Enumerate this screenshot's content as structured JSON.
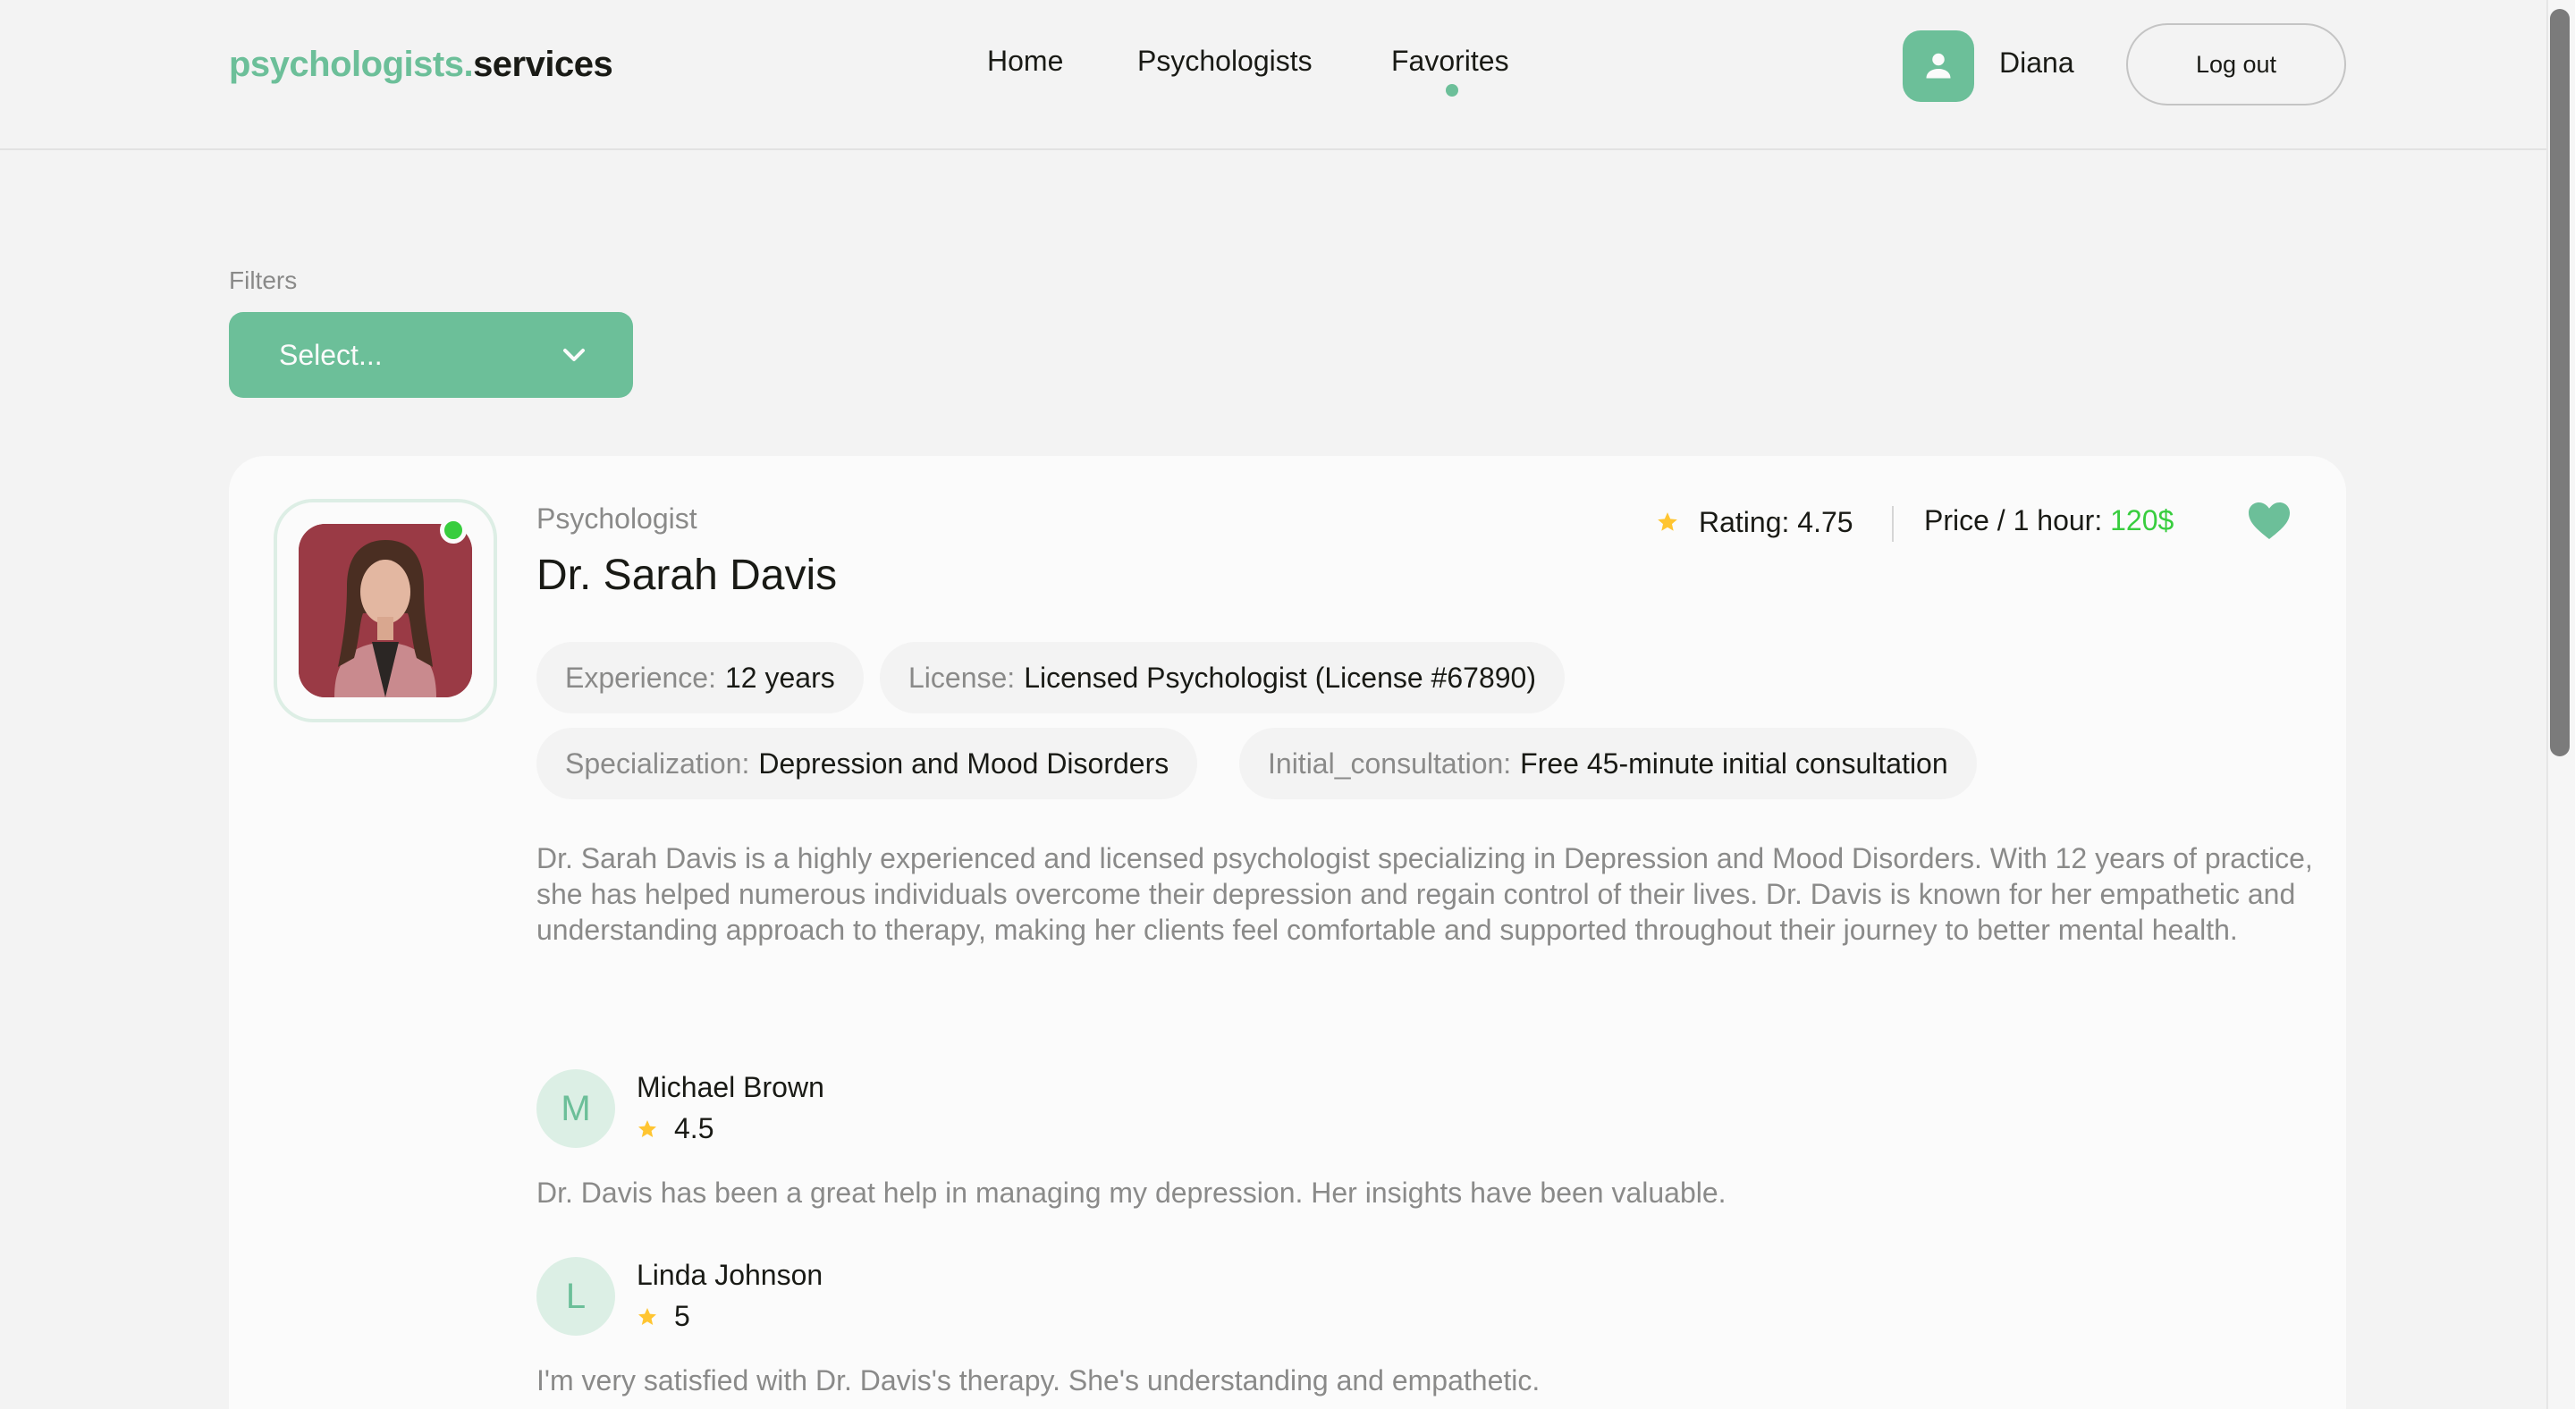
{
  "header": {
    "logo_accent": "psychologists.",
    "logo_main": "services",
    "nav": {
      "home": "Home",
      "psychologists": "Psychologists",
      "favorites": "Favorites"
    },
    "user_name": "Diana",
    "logout_label": "Log out"
  },
  "filters": {
    "label": "Filters",
    "selected": "Select..."
  },
  "psychologist": {
    "role": "Psychologist",
    "name": "Dr. Sarah Davis",
    "rating_label": "Rating: 4.75",
    "price_label": "Price / 1 hour: ",
    "price_value": "120$",
    "online": true,
    "favorite": true,
    "details": [
      {
        "key": "Experience:",
        "value": "12 years"
      },
      {
        "key": "License:",
        "value": "Licensed Psychologist (License #67890)"
      },
      {
        "key": "Specialization:",
        "value": "Depression and Mood Disorders"
      },
      {
        "key": "Initial_consultation:",
        "value": "Free 45-minute initial consultation"
      }
    ],
    "about": "Dr. Sarah Davis is a highly experienced and licensed psychologist specializing in Depression and Mood Disorders. With 12 years of practice, she has helped numerous individuals overcome their depression and regain control of their lives. Dr. Davis is known for her empathetic and understanding approach to therapy, making her clients feel comfortable and supported throughout their journey to better mental health.",
    "reviews": [
      {
        "initial": "M",
        "name": "Michael Brown",
        "rating": "4.5",
        "comment": "Dr. Davis has been a great help in managing my depression. Her insights have been valuable."
      },
      {
        "initial": "L",
        "name": "Linda Johnson",
        "rating": "5",
        "comment": "I'm very satisfied with Dr. Davis's therapy. She's understanding and empathetic."
      }
    ]
  },
  "colors": {
    "brand": "#6cbf99",
    "online": "#38cd3e",
    "star": "#ffc531",
    "muted_text": "#8a8a89"
  },
  "icons": [
    "user-icon",
    "chevron-down-icon",
    "star-icon",
    "heart-icon"
  ]
}
